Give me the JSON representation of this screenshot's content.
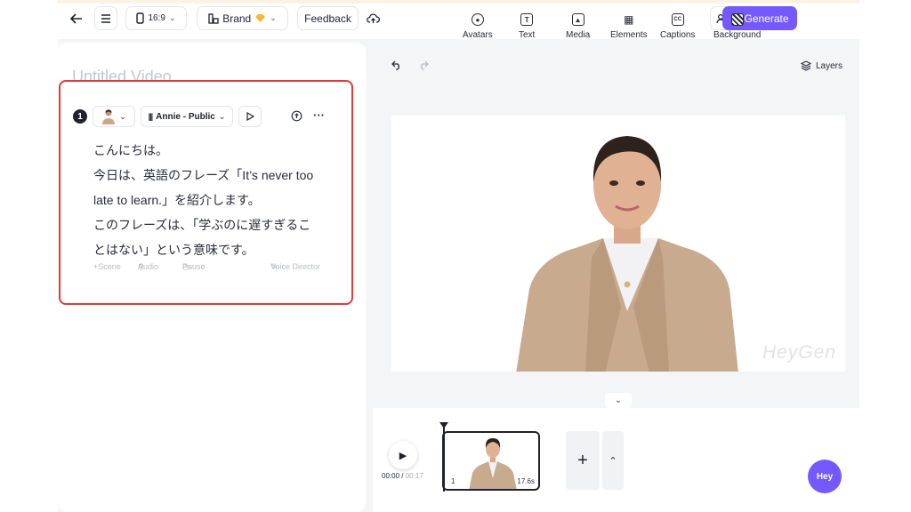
{
  "topbar": {
    "aspect_label": "16:9",
    "brand_label": "Brand",
    "feedback_label": "Feedback",
    "generate_label": "Generate"
  },
  "project": {
    "title": "Untitled Video"
  },
  "scene": {
    "number": "1",
    "voice_label": "Annie - Public",
    "script_lines": [
      "こんにちは。",
      "今日は、英語のフレーズ「It’s never too",
      "late to learn.」を紹介します。",
      "このフレーズは、「学ぶのに遅すぎるこ",
      "とはない」という意味です。"
    ],
    "actions": {
      "scene": "Scene",
      "audio": "Audio",
      "pause": "Pause",
      "voice_director": "Voice Director"
    }
  },
  "tools": {
    "avatars": "Avatars",
    "text": "Text",
    "media": "Media",
    "elements": "Elements",
    "captions": "Captions",
    "background": "Background",
    "layers": "Layers"
  },
  "canvas": {
    "watermark": "HeyGen"
  },
  "timeline": {
    "current_time": "00:00",
    "total_time": "00:17",
    "clip_index": "1",
    "clip_duration": "17.6s"
  },
  "assistant": {
    "label": "Hey"
  },
  "colors": {
    "accent": "#7559ff",
    "highlight_border": "#e03a3a",
    "text": "#1f2130"
  }
}
